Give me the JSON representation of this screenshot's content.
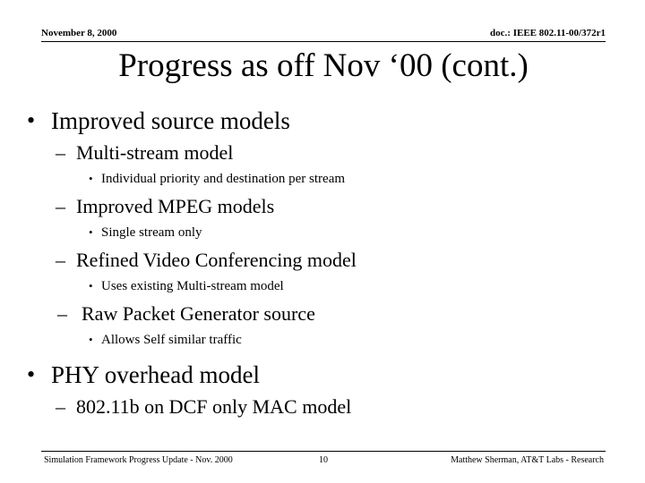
{
  "header": {
    "date": "November 8, 2000",
    "doc": "doc.: IEEE 802.11-00/372r1"
  },
  "title": "Progress as off Nov ‘00 (cont.)",
  "bullets": [
    {
      "level": 1,
      "marker": "•",
      "text": "Improved source models"
    },
    {
      "level": 2,
      "marker": "–",
      "text": "Multi-stream model"
    },
    {
      "level": 3,
      "marker": "•",
      "text": "Individual priority and destination per stream"
    },
    {
      "level": 2,
      "marker": "–",
      "text": "Improved MPEG models"
    },
    {
      "level": 3,
      "marker": "•",
      "text": "Single stream only"
    },
    {
      "level": 2,
      "marker": "–",
      "text": "Refined Video Conferencing model"
    },
    {
      "level": 3,
      "marker": "•",
      "text": "Uses existing Multi-stream model"
    },
    {
      "level": 2,
      "marker": "–",
      "text": "Raw Packet Generator source"
    },
    {
      "level": 3,
      "marker": "•",
      "text": "Allows Self similar traffic"
    },
    {
      "level": 1,
      "marker": "•",
      "text": "PHY overhead model"
    },
    {
      "level": 2,
      "marker": "–",
      "text": "802.11b on DCF only MAC model"
    }
  ],
  "footer": {
    "left": "Simulation Framework Progress Update - Nov. 2000",
    "page": "10",
    "right": "Matthew Sherman, AT&T Labs - Research"
  },
  "colors": {
    "text": "#000000",
    "background": "#ffffff",
    "rule": "#000000"
  }
}
